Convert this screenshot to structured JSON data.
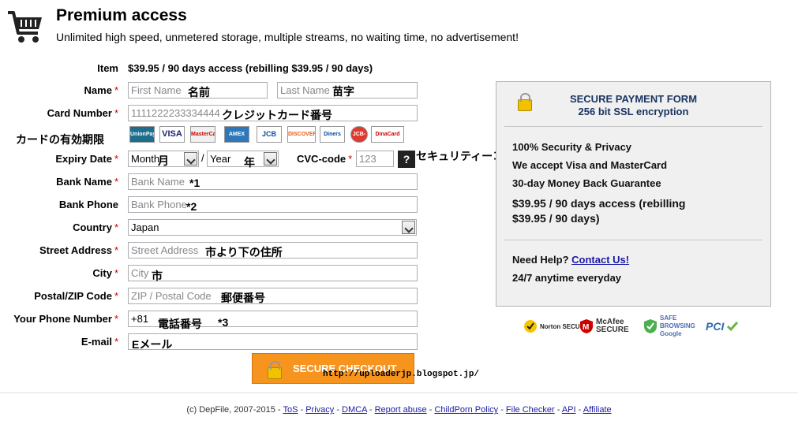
{
  "header": {
    "title": "Premium access",
    "subtitle": "Unlimited high speed, unmetered storage, multiple streams, no waiting time, no advertisement!"
  },
  "form": {
    "item_label": "Item",
    "item_value": "$39.95 / 90 days access (rebilling $39.95 / 90 days)",
    "name_label": "Name",
    "first_name_placeholder": "First Name",
    "first_name_note": "名前",
    "last_name_placeholder": "Last Name",
    "last_name_note": "苗字",
    "card_number_label": "Card Number",
    "card_number_placeholder": "1111222233334444",
    "card_number_note": "クレジットカード番号",
    "card_expiry_note": "カードの有効期限",
    "card_logos": [
      "UnionPay",
      "VISA",
      "MasterCard",
      "AMEX",
      "JCB",
      "DISCOVER",
      "Diners Club",
      "JCB-red",
      "DinaCard"
    ],
    "expiry_label": "Expiry Date",
    "month_value": "Month",
    "month_note": "月",
    "year_value": "Year",
    "year_note": "年",
    "cvc_label": "CVC-code",
    "cvc_placeholder": "123",
    "cvc_help": "?",
    "cvc_note": "セキュリティーコード",
    "bank_name_label": "Bank Name",
    "bank_name_placeholder": "Bank Name",
    "bank_name_note": "*1",
    "bank_phone_label": "Bank Phone",
    "bank_phone_placeholder": "Bank Phone",
    "bank_phone_note": "*2",
    "country_label": "Country",
    "country_value": "Japan",
    "street_label": "Street Address",
    "street_placeholder": "Street Address",
    "street_note": "市より下の住所",
    "city_label": "City",
    "city_placeholder": "City",
    "city_note": "市",
    "zip_label": "Postal/ZIP Code",
    "zip_placeholder": "ZIP / Postal Code",
    "zip_note": "郵便番号",
    "phone_label": "Your Phone Number",
    "phone_value": "+81",
    "phone_note": "電話番号",
    "phone_note2": "*3",
    "email_label": "E-mail",
    "email_note": "Eメール",
    "checkout_label": "SECURE CHECKOUT",
    "watermark": "http://uploaderjp.blogspot.jp/"
  },
  "panel": {
    "title1": "SECURE PAYMENT FORM",
    "title2": "256 bit SSL encryption",
    "point1": "100% Security & Privacy",
    "point2": "We accept Visa and MasterCard",
    "point3": "30-day Money Back Guarantee",
    "price1": "$39.95 / 90 days access (rebilling",
    "price2": "$39.95 / 90 days)",
    "help_text": "Need Help?",
    "contact_link": "Contact Us!",
    "hours": "24/7 anytime everyday"
  },
  "badges": [
    "Norton SECURED",
    "McAfee SECURE",
    "SAFE BROWSING Google",
    "PCI"
  ],
  "footer": {
    "copyright": "(c) DepFile, 2007-2015 -",
    "links": [
      "ToS",
      "Privacy",
      "DMCA",
      "Report abuse",
      "ChildPorn Policy",
      "File Checker",
      "API",
      "Affiliate"
    ]
  },
  "colors": {
    "checkout": "#f7941d",
    "panel_title": "#1a3560",
    "required": "#cc0000",
    "link": "#1a1aa6"
  }
}
